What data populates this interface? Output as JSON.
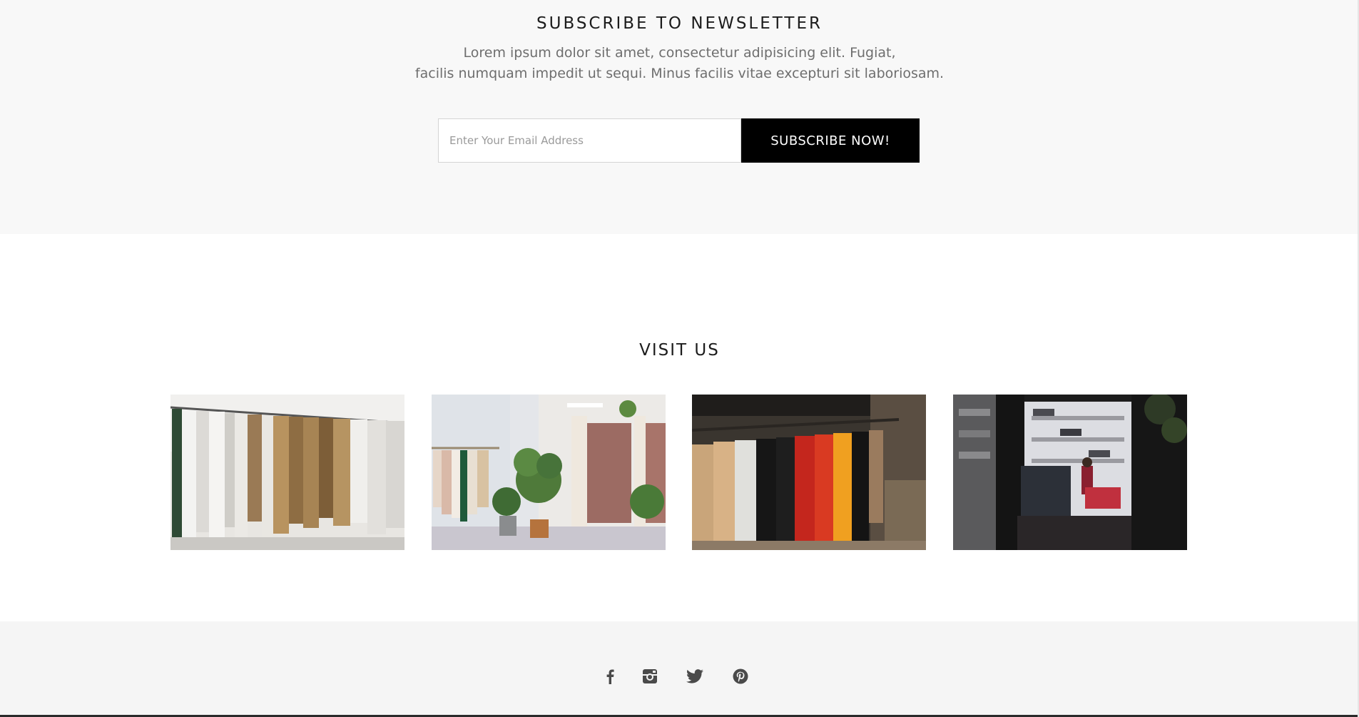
{
  "newsletter": {
    "title": "SUBSCRIBE TO NEWSLETTER",
    "description_line1": "Lorem ipsum dolor sit amet, consectetur adipisicing elit. Fugiat,",
    "description_line2": "facilis numquam impedit ut sequi. Minus facilis vitae excepturi sit laboriosam.",
    "email_placeholder": "Enter Your Email Address",
    "email_value": "",
    "button_label": "SUBSCRIBE NOW!"
  },
  "visit": {
    "title": "VISIT US",
    "gallery": [
      {
        "icon": "clothing-rack-photo"
      },
      {
        "icon": "boutique-interior-photo"
      },
      {
        "icon": "shirts-on-hangers-photo"
      },
      {
        "icon": "dark-store-interior-photo"
      }
    ]
  },
  "footer": {
    "social": [
      {
        "icon": "facebook-icon"
      },
      {
        "icon": "instagram-icon"
      },
      {
        "icon": "twitter-icon"
      },
      {
        "icon": "pinterest-icon"
      }
    ]
  },
  "colors": {
    "button_bg": "#000000",
    "section_bg": "#f8f8f8",
    "icon_color": "#4a4a4a"
  }
}
